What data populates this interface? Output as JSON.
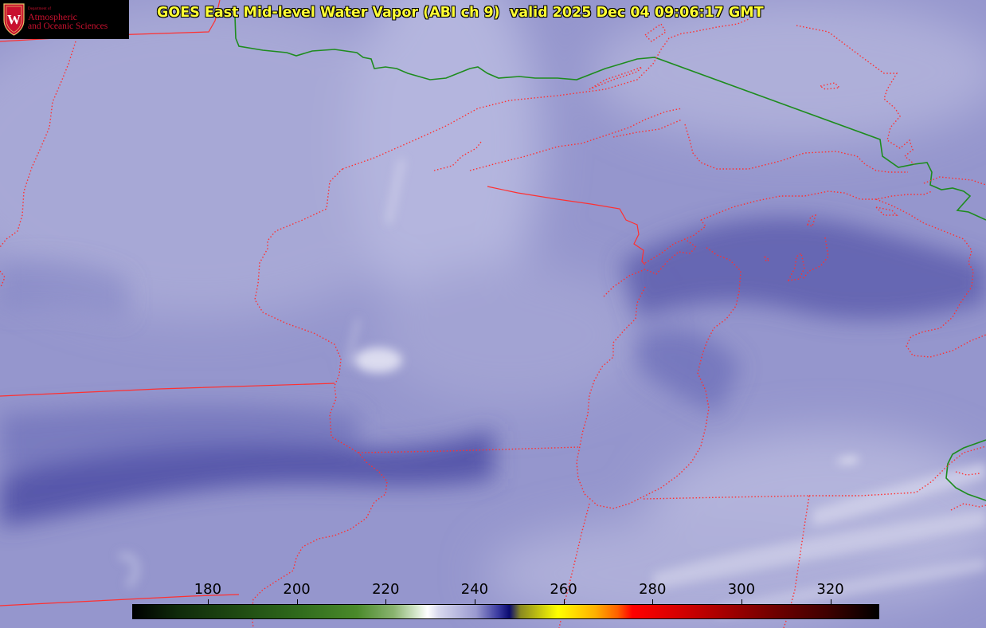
{
  "title": "GOES East Mid-level Water Vapor (ABI ch 9)  valid 2025 Dec 04 09:06:17 GMT",
  "logo": {
    "dept_label": "Department of",
    "line1": "Atmospheric",
    "line2": "and Oceanic Sciences",
    "shield_letter": "W"
  },
  "colorbar": {
    "ticks": [
      "180",
      "200",
      "220",
      "240",
      "260",
      "280",
      "300",
      "320"
    ],
    "tick_values": [
      180,
      200,
      220,
      240,
      260,
      280,
      300,
      320
    ],
    "range": [
      163,
      331
    ]
  },
  "colors": {
    "state_borders": "#ff3030",
    "international_border": "#1e8c1e",
    "lake_shore": "#ff3030",
    "title_text": "#ffff33",
    "logo_red": "#c8102e"
  }
}
